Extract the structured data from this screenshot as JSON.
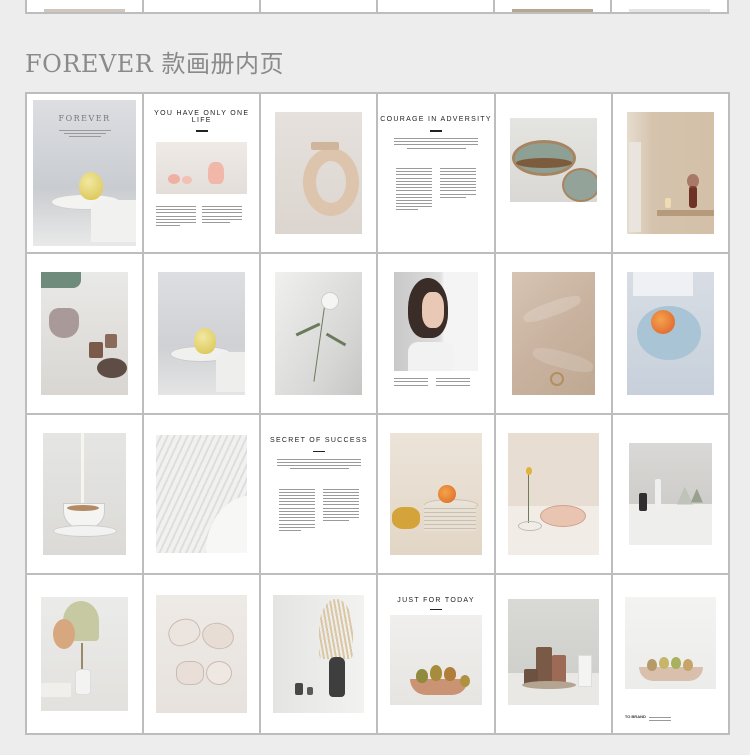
{
  "section_title": "FOREVER 款画册内页",
  "pages": {
    "cover": {
      "brand": "FOREVER"
    },
    "p2": {
      "title": "YOU HAVE ONLY ONE LIFE"
    },
    "p4": {
      "title": "COURAGE IN ADVERSITY"
    },
    "p15": {
      "title": "SECRET OF SUCCESS"
    },
    "p22": {
      "title": "JUST FOR TODAY"
    },
    "p24": {
      "logo": "TO BRAND"
    }
  },
  "colors": {
    "grid_border": "#bdbdbd",
    "background": "#ededed",
    "heading": "#8a8a8a"
  }
}
